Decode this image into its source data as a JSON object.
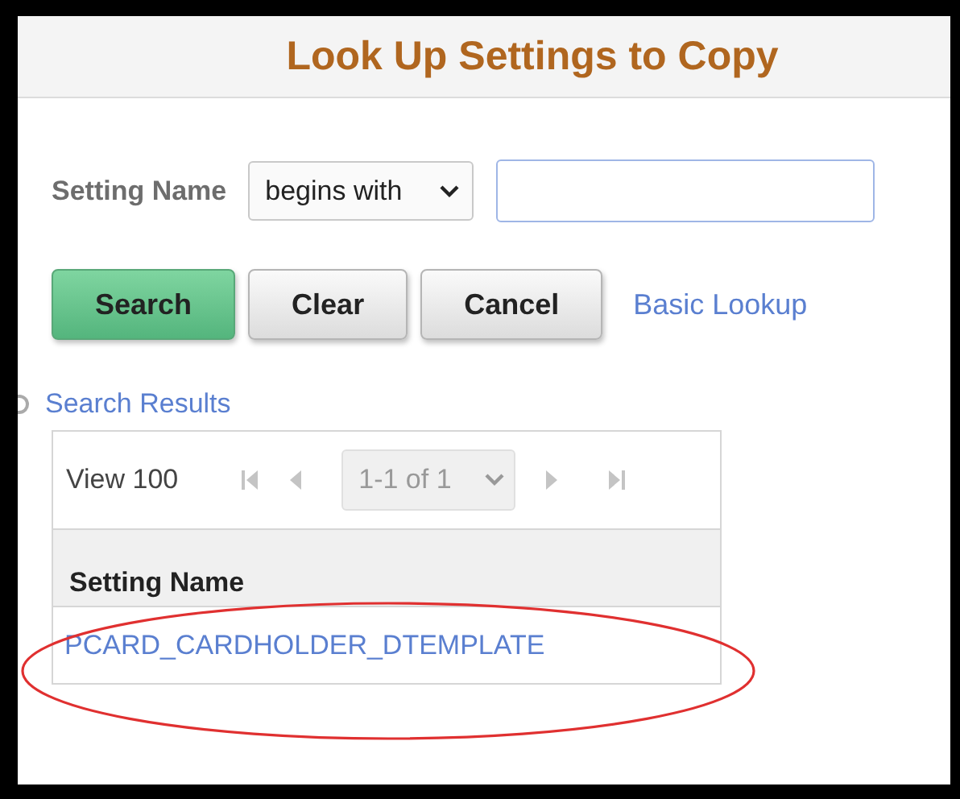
{
  "dialog": {
    "title": "Look Up Settings to Copy"
  },
  "criteria": {
    "label": "Setting Name",
    "operator": "begins with"
  },
  "buttons": [
    {
      "label": "Search",
      "kind": "primary"
    },
    {
      "label": "Clear",
      "kind": "secondary"
    },
    {
      "label": "Cancel",
      "kind": "secondary"
    }
  ],
  "link": "Basic Lookup",
  "results": {
    "title": "Search Results",
    "view": "View 100",
    "page": "1-1 of 1",
    "columns": [
      "Setting Name"
    ],
    "rows": [
      [
        "PCARD_CARDHOLDER_DTEMPLATE"
      ]
    ]
  },
  "annotation": {
    "kind": "ellipse"
  }
}
